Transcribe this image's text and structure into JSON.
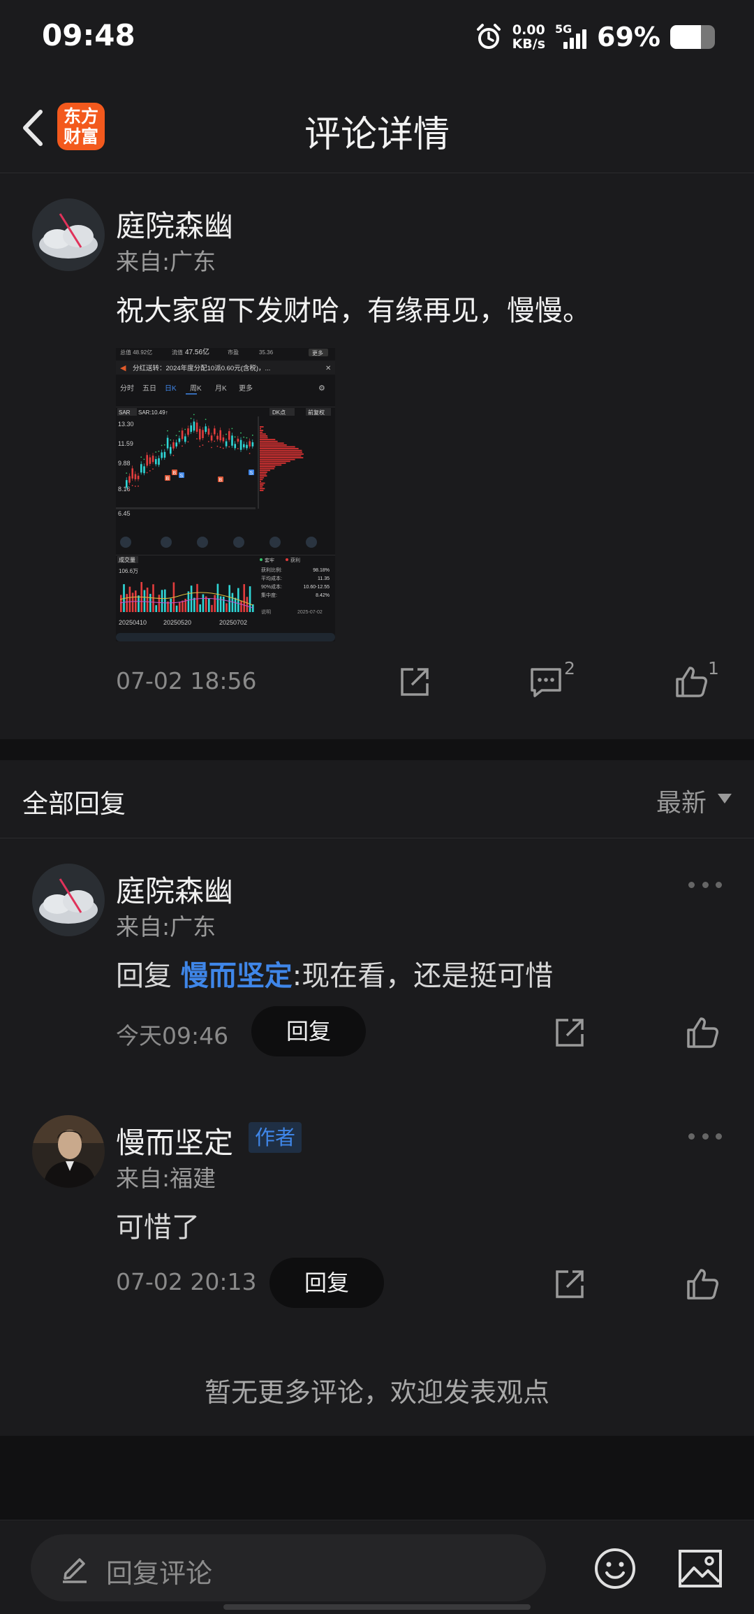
{
  "status_bar": {
    "time": "09:48",
    "net_speed_value": "0.00",
    "net_speed_unit": "KB/s",
    "network": "5G",
    "battery_percent": "69%",
    "battery_level": 0.69
  },
  "header": {
    "title": "评论详情",
    "app_logo_line1": "东方",
    "app_logo_line2": "财富"
  },
  "post": {
    "author": "庭院森幽",
    "location": "来自:广东",
    "text": "祝大家留下发财哈，有缘再见，慢慢。",
    "time": "07-02 18:56",
    "comment_count": "2",
    "like_count": "1",
    "stock_image": {
      "total_cap": "总值 48.92亿",
      "float_label": "流值",
      "float_cap": "47.56亿",
      "pe_label": "市盈",
      "pe_value": "35.36",
      "more": "更多",
      "dividend_notice": "分红送转：2024年度分配10派0.60元(含税)，...",
      "tabs": [
        "分时",
        "五日",
        "日K",
        "周K",
        "月K",
        "更多"
      ],
      "indicator": "SAR",
      "sar_value": "SAR:10.49↑",
      "dk_label": "DK点",
      "adjust_label": "前复权",
      "price_ticks": [
        "13.30",
        "11.59",
        "9.88",
        "8.16",
        "6.45"
      ],
      "volume_label": "成交量",
      "volume_max": "106.6万",
      "chip_legend_1": "套牢",
      "chip_legend_2": "获利",
      "chip_stats": [
        {
          "label": "获利比例:",
          "value": "98.18%"
        },
        {
          "label": "平均成本:",
          "value": "11.35"
        },
        {
          "label": "90%成本:",
          "value": "10.60-12.55"
        },
        {
          "label": "集中度:",
          "value": "8.42%"
        }
      ],
      "chip_date": "2025-07-02",
      "chip_note": "说明",
      "dates": [
        "20250410",
        "20250520",
        "20250702"
      ]
    }
  },
  "replies_header": {
    "title": "全部回复",
    "sort": "最新"
  },
  "replies": [
    {
      "author": "庭院森幽",
      "location": "来自:广东",
      "reply_prefix": "回复",
      "mention": "慢而坚定",
      "text": ":现在看，还是挺可惜",
      "time": "今天09:46",
      "reply_button": "回复"
    },
    {
      "author": "慢而坚定",
      "badge": "作者",
      "location": "来自:福建",
      "text": "可惜了",
      "time": "07-02 20:13",
      "reply_button": "回复"
    }
  ],
  "no_more_text": "暂无更多评论，欢迎发表观点",
  "bottom_bar": {
    "placeholder": "回复评论"
  }
}
